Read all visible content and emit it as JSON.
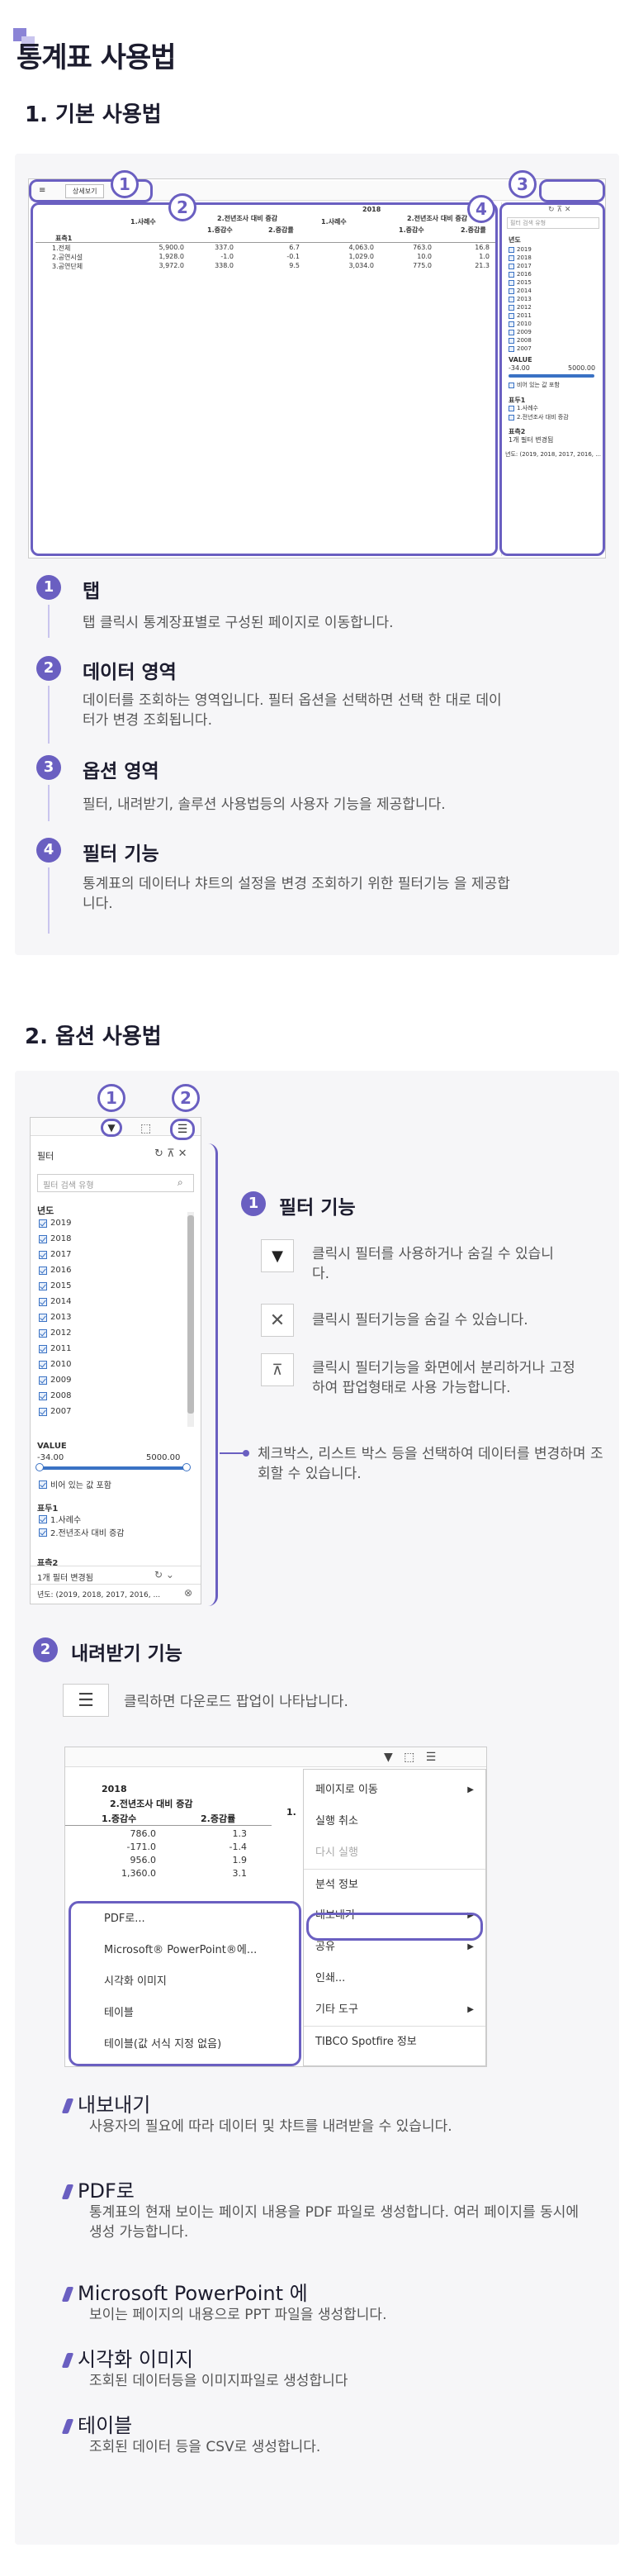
{
  "page_title": "통계표 사용법",
  "section1": {
    "heading": "1. 기본 사용법",
    "screenshot": {
      "tab_home": "≡",
      "tab_detail": "상세보기",
      "year": "2018",
      "group_headers": [
        "1.사례수",
        "2.전년조사 대비 증감",
        "1.사례수",
        "2.전년조사 대비 증감"
      ],
      "sub_headers": [
        "1.증감수",
        "2.증감률",
        "1.증감수",
        "2.증감률"
      ],
      "row_header": "표측1",
      "rows": [
        {
          "label": "1.전체",
          "values": [
            "5,900.0",
            "337.0",
            "6.7",
            "4,063.0",
            "763.0",
            "16.8"
          ]
        },
        {
          "label": "2.공연시설",
          "values": [
            "1,928.0",
            "-1.0",
            "-0.1",
            "1,029.0",
            "10.0",
            "1.0"
          ]
        },
        {
          "label": "3.공연단체",
          "values": [
            "3,972.0",
            "338.0",
            "9.5",
            "3,034.0",
            "775.0",
            "21.3"
          ]
        }
      ],
      "filter_search": "필터 검색 유형",
      "filter_section": "년도",
      "years": [
        "2019",
        "2018",
        "2017",
        "2016",
        "2015",
        "2014",
        "2013",
        "2012",
        "2011",
        "2010",
        "2009",
        "2008",
        "2007"
      ],
      "value_label": "VALUE",
      "value_min": "-34.00",
      "value_max": "5000.00",
      "empty_value": "비어 있는 값 포함",
      "dim1": "표두1",
      "dim1_items": [
        "1.사례수",
        "2.전년조사 대비 증감"
      ],
      "dim2": "표측2",
      "filter_changed": "1개 필터 변경됨",
      "filter_summary": "년도: (2019, 2018, 2017, 2016, ..."
    },
    "callouts": [
      "1",
      "2",
      "3",
      "4"
    ],
    "items": [
      {
        "num": "1",
        "title": "탭",
        "desc": "탭 클릭시 통계장표별로 구성된 페이지로 이동합니다."
      },
      {
        "num": "2",
        "title": "데이터 영역",
        "desc": "데이터를 조회하는 영역입니다. 필터 옵션을 선택하면 선택 한 대로 데이터가 변경 조회됩니다."
      },
      {
        "num": "3",
        "title": "옵션 영역",
        "desc": "필터, 내려받기, 솔루션 사용법등의 사용자 기능을 제공합니다."
      },
      {
        "num": "4",
        "title": "필터 기능",
        "desc": "통계표의 데이터나 챠트의 설정을 변경 조회하기 위한 필터기능 을 제공합니다."
      }
    ]
  },
  "section2": {
    "heading": "2. 옵션 사용법",
    "filter_panel": {
      "title": "필터",
      "search_placeholder": "필터 검색 유형",
      "section_label": "년도",
      "years": [
        "2019",
        "2018",
        "2017",
        "2016",
        "2015",
        "2014",
        "2013",
        "2012",
        "2011",
        "2010",
        "2009",
        "2008",
        "2007"
      ],
      "value_label": "VALUE",
      "value_min": "-34.00",
      "value_max": "5000.00",
      "empty_value": "비어 있는 값 포함",
      "dim1": "표두1",
      "dim1_items": [
        "1.사례수",
        "2.전년조사 대비 증감"
      ],
      "dim2": "표측2",
      "filter_changed": "1개 필터 변경됨",
      "filter_summary": "년도: (2019, 2018, 2017, 2016, ..."
    },
    "filter_feature": {
      "num": "1",
      "title": "필터 기능",
      "icon_descs": [
        "클릭시 필터를 사용하거나 숨길 수 있습니다.",
        "클릭시 필터기능을 숨길 수 있습니다.",
        "클릭시 필터기능을 화면에서 분리하거나 고정하여 팝업형태로 사용 가능합니다."
      ],
      "note": "체크박스, 리스트 박스 등을 선택하여 데이터를 변경하며 조회할 수 있습니다."
    },
    "download_feature": {
      "num": "2",
      "title": "내려받기 기능",
      "icon_desc": "클릭하면 다운로드 팝업이 나타납니다.",
      "table": {
        "year": "2018",
        "group": "2.전년조사 대비 증감",
        "group2": "1.",
        "sub": [
          "1.증감수",
          "2.증감률"
        ],
        "rows": [
          [
            "786.0",
            "1.3"
          ],
          [
            "-171.0",
            "-1.4"
          ],
          [
            "956.0",
            "1.9"
          ],
          [
            "1,360.0",
            "3.1"
          ]
        ]
      },
      "main_menu": [
        "페이지로 이동",
        "실행 취소",
        "다시 실행",
        "분석 정보",
        "내보내기",
        "공유",
        "인쇄...",
        "기타 도구",
        "TIBCO Spotfire 정보"
      ],
      "sub_menu": [
        "PDF로...",
        "Microsoft® PowerPoint®에...",
        "시각화 이미지",
        "테이블",
        "테이블(값 서식 지정 없음)"
      ]
    },
    "exports": [
      {
        "title": "내보내기",
        "desc": "사용자의 필요에 따라  데이터 및 챠트를 내려받을 수 있습니다."
      },
      {
        "title": "PDF로",
        "desc": "통계표의 현재 보이는 페이지 내용을 PDF 파일로 생성합니다. 여러 페이지를 동시에 생성 가능합니다."
      },
      {
        "title": "Microsoft PowerPoint 에",
        "desc": "보이는 페이지의 내용으로 PPT 파일을 생성합니다."
      },
      {
        "title": "시각화 이미지",
        "desc": "조회된 데이터등을 이미지파일로 생성합니다"
      },
      {
        "title": "테이블",
        "desc": "조회된 데이터 등을 CSV로 생성합니다."
      }
    ]
  },
  "colors": {
    "accent": "#6a5fc1",
    "accent_light": "#c9c5ee",
    "panel": "#f6f6f8"
  }
}
